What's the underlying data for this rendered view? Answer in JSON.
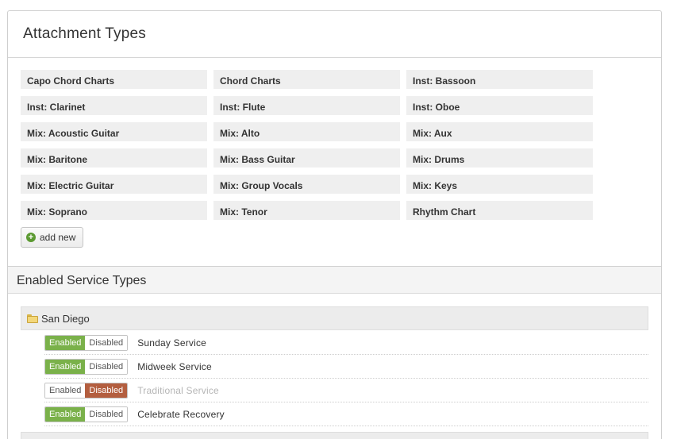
{
  "panel": {
    "title": "Attachment Types"
  },
  "attachment_types": [
    "Capo Chord Charts",
    "Chord Charts",
    "Inst: Bassoon",
    "Inst: Clarinet",
    "Inst: Flute",
    "Inst: Oboe",
    "Mix: Acoustic Guitar",
    "Mix: Alto",
    "Mix: Aux",
    "Mix: Baritone",
    "Mix: Bass Guitar",
    "Mix: Drums",
    "Mix: Electric Guitar",
    "Mix: Group Vocals",
    "Mix: Keys",
    "Mix: Soprano",
    "Mix: Tenor",
    "Rhythm Chart"
  ],
  "add_new_label": "add new",
  "enabled_service_types": {
    "title": "Enabled Service Types",
    "group": "San Diego",
    "toggle_labels": {
      "enabled": "Enabled",
      "disabled": "Disabled"
    },
    "services": [
      {
        "name": "Sunday Service",
        "state": "enabled"
      },
      {
        "name": "Midweek Service",
        "state": "enabled"
      },
      {
        "name": "Traditional Service",
        "state": "disabled"
      },
      {
        "name": "Celebrate Recovery",
        "state": "enabled"
      }
    ]
  },
  "colors": {
    "enabled": "#7ab14a",
    "disabled": "#b35e3f",
    "add_icon": "#5c9a32"
  }
}
